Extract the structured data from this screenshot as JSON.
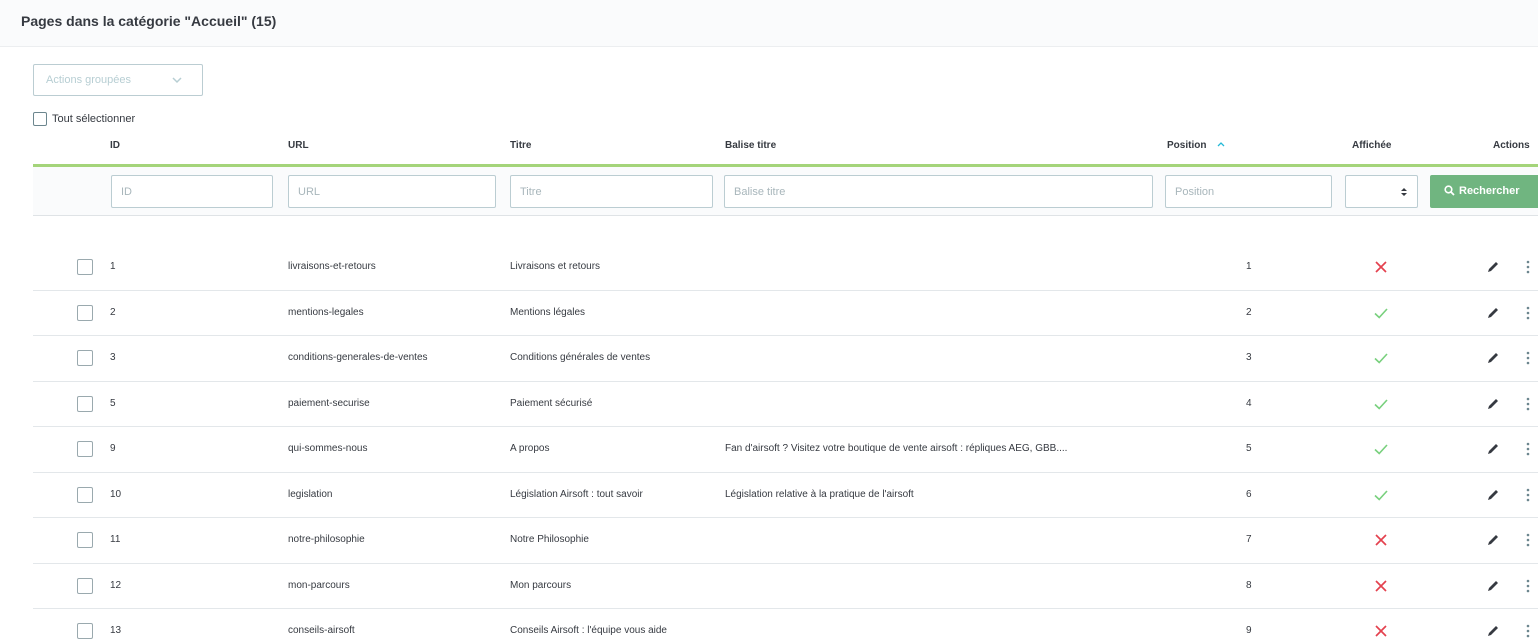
{
  "header": {
    "title": "Pages dans la catégorie \"Accueil\" (15)"
  },
  "toolbar": {
    "bulk_actions_label": "Actions groupées",
    "select_all_label": "Tout sélectionner"
  },
  "columns": {
    "id": "ID",
    "url": "URL",
    "title": "Titre",
    "meta_title": "Balise titre",
    "position": "Position",
    "displayed": "Affichée",
    "actions": "Actions"
  },
  "filters": {
    "id_placeholder": "ID",
    "url_placeholder": "URL",
    "title_placeholder": "Titre",
    "meta_title_placeholder": "Balise titre",
    "position_placeholder": "Position",
    "search_label": "Rechercher"
  },
  "colors": {
    "accent_green": "#70b580",
    "header_line": "#a4d47a",
    "check": "#78d07d",
    "cross": "#e4414e"
  },
  "rows": [
    {
      "id": "1",
      "url": "livraisons-et-retours",
      "title": "Livraisons et retours",
      "meta_title": "",
      "position": "1",
      "displayed": false
    },
    {
      "id": "2",
      "url": "mentions-legales",
      "title": "Mentions légales",
      "meta_title": "",
      "position": "2",
      "displayed": true
    },
    {
      "id": "3",
      "url": "conditions-generales-de-ventes",
      "title": "Conditions générales de ventes",
      "meta_title": "",
      "position": "3",
      "displayed": true
    },
    {
      "id": "5",
      "url": "paiement-securise",
      "title": "Paiement sécurisé",
      "meta_title": "",
      "position": "4",
      "displayed": true
    },
    {
      "id": "9",
      "url": "qui-sommes-nous",
      "title": "A propos",
      "meta_title": "Fan d'airsoft ? Visitez votre boutique de vente airsoft : répliques AEG, GBB....",
      "position": "5",
      "displayed": true
    },
    {
      "id": "10",
      "url": "legislation",
      "title": "Législation Airsoft : tout savoir",
      "meta_title": "Législation relative à la pratique de l'airsoft",
      "position": "6",
      "displayed": true
    },
    {
      "id": "11",
      "url": "notre-philosophie",
      "title": "Notre Philosophie",
      "meta_title": "",
      "position": "7",
      "displayed": false
    },
    {
      "id": "12",
      "url": "mon-parcours",
      "title": "Mon parcours",
      "meta_title": "",
      "position": "8",
      "displayed": false
    },
    {
      "id": "13",
      "url": "conseils-airsoft",
      "title": "Conseils Airsoft : l'équipe vous aide",
      "meta_title": "",
      "position": "9",
      "displayed": false
    }
  ]
}
